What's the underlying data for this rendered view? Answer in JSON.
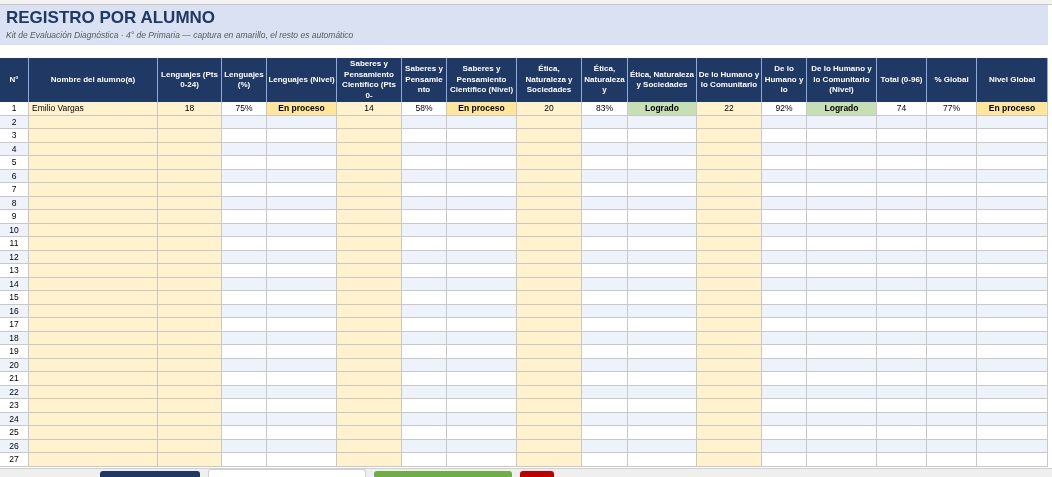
{
  "title": "REGISTRO POR ALUMNO",
  "subtitle": "Kit de Evaluación Diagnóstica · 4° de Primaria — captura en amarillo, el resto es automático",
  "columns": [
    {
      "header": "N°",
      "kind": "number"
    },
    {
      "header": "Nombre del alumno(a)",
      "kind": "input"
    },
    {
      "header": "Lenguajes (Pts 0-24)",
      "kind": "input"
    },
    {
      "header": "Lenguajes (%)",
      "kind": "calc"
    },
    {
      "header": "Lenguajes (Nivel)",
      "kind": "level"
    },
    {
      "header": "Saberes y Pensamiento Científico (Pts 0-",
      "kind": "input"
    },
    {
      "header": "Saberes y Pensamiento",
      "kind": "calc"
    },
    {
      "header": "Saberes y Pensamiento Científico (Nivel)",
      "kind": "level"
    },
    {
      "header": "Ética, Naturaleza y Sociedades",
      "kind": "input"
    },
    {
      "header": "Ética, Naturaleza y",
      "kind": "calc"
    },
    {
      "header": "Ética, Naturaleza y Sociedades",
      "kind": "level"
    },
    {
      "header": "De lo Humano y lo Comunitario",
      "kind": "input"
    },
    {
      "header": "De lo Humano y lo",
      "kind": "calc"
    },
    {
      "header": "De lo Humano y lo Comunitario (Nivel)",
      "kind": "level"
    },
    {
      "header": "Total (0-96)",
      "kind": "calc"
    },
    {
      "header": "% Global",
      "kind": "calc"
    },
    {
      "header": "Nivel Global",
      "kind": "level"
    }
  ],
  "rows": [
    {
      "n": "1",
      "cells": [
        {
          "text": "Emilio Vargas"
        },
        {
          "text": "18"
        },
        {
          "text": "75%"
        },
        {
          "text": "En proceso",
          "color": "#ffe699"
        },
        {
          "text": "14"
        },
        {
          "text": "58%"
        },
        {
          "text": "En proceso",
          "color": "#ffe699"
        },
        {
          "text": "20"
        },
        {
          "text": "83%"
        },
        {
          "text": "Logrado",
          "color": "#c6e0b4"
        },
        {
          "text": "22"
        },
        {
          "text": "92%"
        },
        {
          "text": "Logrado",
          "color": "#c6e0b4"
        },
        {
          "text": "74"
        },
        {
          "text": "77%"
        },
        {
          "text": "En proceso",
          "color": "#ffe699"
        }
      ]
    },
    {
      "n": "2"
    },
    {
      "n": "3"
    },
    {
      "n": "4"
    },
    {
      "n": "5"
    },
    {
      "n": "6"
    },
    {
      "n": "7"
    },
    {
      "n": "8"
    },
    {
      "n": "9"
    },
    {
      "n": "10"
    },
    {
      "n": "11"
    },
    {
      "n": "12"
    },
    {
      "n": "13"
    },
    {
      "n": "14"
    },
    {
      "n": "15"
    },
    {
      "n": "16"
    },
    {
      "n": "17"
    },
    {
      "n": "18"
    },
    {
      "n": "19"
    },
    {
      "n": "20"
    },
    {
      "n": "21"
    },
    {
      "n": "22"
    },
    {
      "n": "23"
    },
    {
      "n": "24"
    },
    {
      "n": "25"
    },
    {
      "n": "26"
    },
    {
      "n": "27"
    }
  ],
  "sheet_tabs": [
    {
      "color": "#1f3864",
      "selected": false
    },
    {
      "color": "#ffffff",
      "selected": true
    },
    {
      "color": "#70ad47",
      "selected": false
    },
    {
      "color": "#c00000",
      "selected": false
    }
  ]
}
